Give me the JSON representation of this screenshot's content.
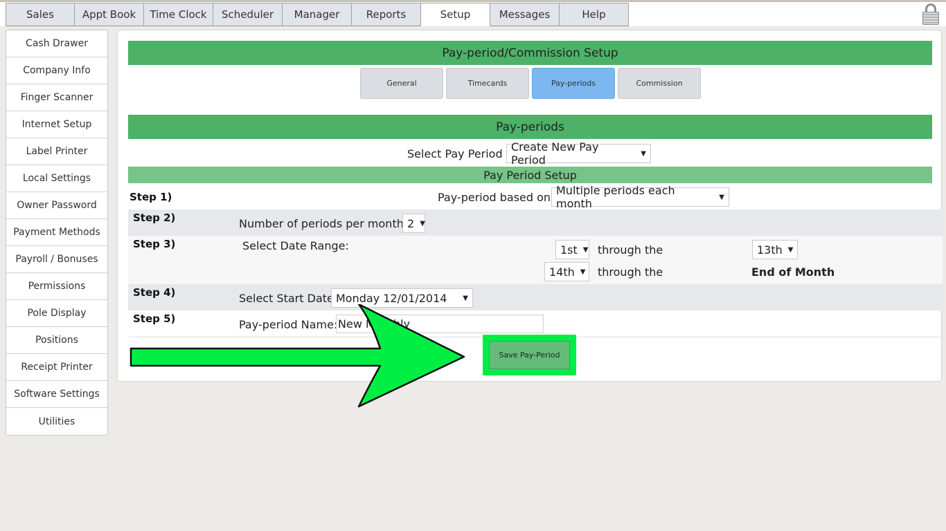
{
  "nav": {
    "tabs": [
      "Sales",
      "Appt Book",
      "Time Clock",
      "Scheduler",
      "Manager",
      "Reports",
      "Setup",
      "Messages",
      "Help"
    ],
    "active_tab": "Setup"
  },
  "icons": {
    "lock": "lock-icon"
  },
  "sidebar": {
    "items": [
      "Cash Drawer",
      "Company Info",
      "Finger Scanner",
      "Internet Setup",
      "Label Printer",
      "Local Settings",
      "Owner Password",
      "Payment Methods",
      "Payroll / Bonuses",
      "Permissions",
      "Pole Display",
      "Positions",
      "Receipt Printer",
      "Software Settings",
      "Utilities"
    ]
  },
  "main": {
    "title": "Pay-period/Commission Setup",
    "subtabs": [
      "General",
      "Timecards",
      "Pay-periods",
      "Commission"
    ],
    "active_subtab": "Pay-periods",
    "section_title": "Pay-periods",
    "select_pay_period_label": "Select Pay Period :",
    "select_pay_period_value": "Create New Pay Period",
    "setup_title": "Pay Period Setup",
    "steps": {
      "s1": {
        "label": "Step 1)",
        "text": "Pay-period based on:",
        "value": "Multiple periods each month"
      },
      "s2": {
        "label": "Step 2)",
        "text": "Number of periods per month:",
        "value": "2"
      },
      "s3": {
        "label": "Step 3)",
        "text": "Select Date Range:",
        "r1_start": "1st",
        "r1_through": "through the",
        "r1_end": "13th",
        "r2_start": "14th",
        "r2_through": "through the",
        "r2_end": "End of Month"
      },
      "s4": {
        "label": "Step 4)",
        "text": "Select Start Date:",
        "value": "Monday 12/01/2014"
      },
      "s5": {
        "label": "Step 5)",
        "text": "Pay-period Name:",
        "value": "New Monthly"
      }
    },
    "save_label": "Save Pay-Period"
  },
  "colors": {
    "header_green": "#4db267",
    "highlight_green": "#00ee44",
    "active_subtab": "#7cb7f0"
  }
}
